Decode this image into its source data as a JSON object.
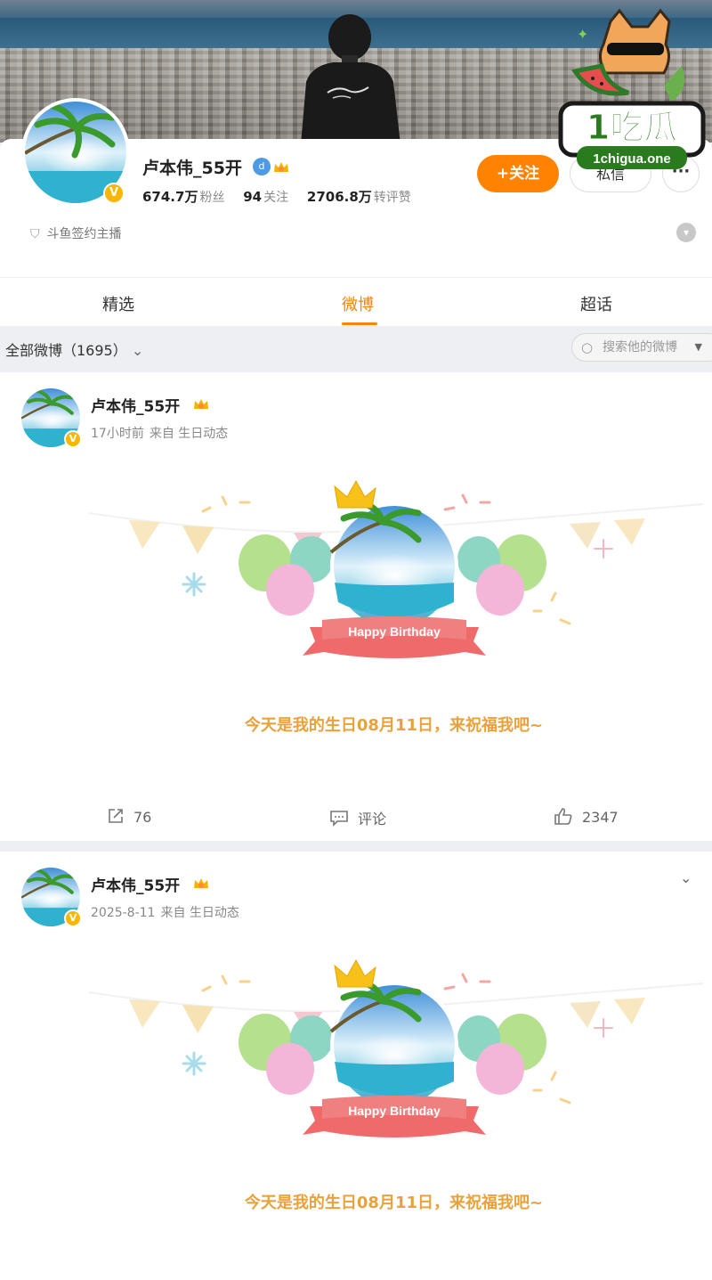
{
  "profile": {
    "name": "卢本伟_55开",
    "fans_count": "674.7万",
    "fans_label": "粉丝",
    "following_count": "94",
    "following_label": "关注",
    "likes_count": "2706.8万",
    "likes_label": "转评赞",
    "follow_button": "+关注",
    "message_button": "私信",
    "more_button": "···",
    "certification": "斗鱼签约主播"
  },
  "tabs": [
    {
      "label": "精选"
    },
    {
      "label": "微博"
    },
    {
      "label": "超话"
    }
  ],
  "filter": {
    "all_label": "全部微博（1695）",
    "search_placeholder": "搜索他的微博"
  },
  "posts": [
    {
      "user": "卢本伟_55开",
      "time": "17小时前",
      "source": "来自 生日动态",
      "banner_text": "Happy Birthday",
      "text": "今天是我的生日08月11日，来祝福我吧~",
      "reposts": "76",
      "comments_label": "评论",
      "likes": "2347"
    },
    {
      "user": "卢本伟_55开",
      "time": "2025-8-11",
      "source": "来自 生日动态",
      "banner_text": "Happy Birthday",
      "text": "今天是我的生日08月11日，来祝福我吧~"
    }
  ],
  "watermark": {
    "logo_text": "1吃瓜",
    "site": "1chigua.one"
  },
  "colors": {
    "accent": "#ff8200",
    "verified_gold": "#f7b700",
    "birthday_text": "#e9a23b"
  }
}
